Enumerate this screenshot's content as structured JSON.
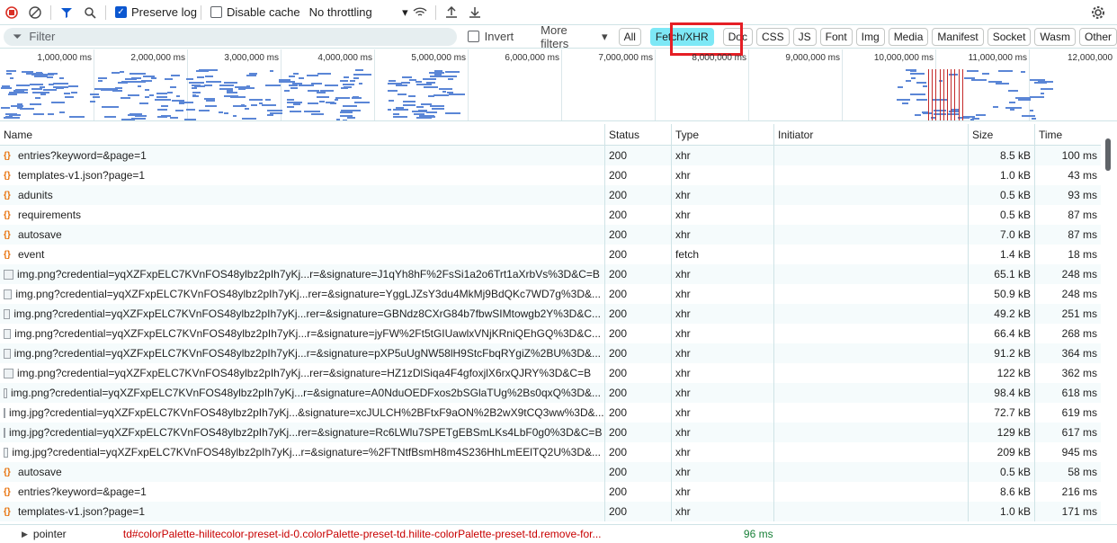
{
  "toolbar": {
    "preserve_log": "Preserve log",
    "disable_cache": "Disable cache",
    "throttling": "No throttling"
  },
  "filterbar": {
    "filter_placeholder": "Filter",
    "invert": "Invert",
    "more_filters": "More filters",
    "chips": [
      "All",
      "Fetch/XHR",
      "Doc",
      "CSS",
      "JS",
      "Font",
      "Img",
      "Media",
      "Manifest",
      "Socket",
      "Wasm",
      "Other"
    ],
    "active_chip": "Fetch/XHR"
  },
  "overview": {
    "ticks": [
      "1,000,000 ms",
      "2,000,000 ms",
      "3,000,000 ms",
      "4,000,000 ms",
      "5,000,000 ms",
      "6,000,000 ms",
      "7,000,000 ms",
      "8,000,000 ms",
      "9,000,000 ms",
      "10,000,000 ms",
      "11,000,000 ms",
      "12,000,000"
    ]
  },
  "table": {
    "headers": {
      "name": "Name",
      "status": "Status",
      "type": "Type",
      "initiator": "Initiator",
      "size": "Size",
      "time": "Time"
    },
    "rows": [
      {
        "icon": "xhr",
        "name": "entries?keyword=&page=1",
        "status": "200",
        "type": "xhr",
        "size": "8.5 kB",
        "time": "100 ms"
      },
      {
        "icon": "xhr",
        "name": "templates-v1.json?page=1",
        "status": "200",
        "type": "xhr",
        "size": "1.0 kB",
        "time": "43 ms"
      },
      {
        "icon": "xhr",
        "name": "adunits",
        "status": "200",
        "type": "xhr",
        "size": "0.5 kB",
        "time": "93 ms"
      },
      {
        "icon": "xhr",
        "name": "requirements",
        "status": "200",
        "type": "xhr",
        "size": "0.5 kB",
        "time": "87 ms"
      },
      {
        "icon": "xhr",
        "name": "autosave",
        "status": "200",
        "type": "xhr",
        "size": "7.0 kB",
        "time": "87 ms"
      },
      {
        "icon": "xhr",
        "name": "event",
        "status": "200",
        "type": "fetch",
        "size": "1.4 kB",
        "time": "18 ms"
      },
      {
        "icon": "img",
        "name": "img.png?credential=yqXZFxpELC7KVnFOS48ylbz2pIh7yKj...r=&signature=J1qYh8hF%2FsSi1a2o6Trt1aXrbVs%3D&C=B",
        "status": "200",
        "type": "xhr",
        "size": "65.1 kB",
        "time": "248 ms"
      },
      {
        "icon": "img",
        "name": "img.png?credential=yqXZFxpELC7KVnFOS48ylbz2pIh7yKj...rer=&signature=YggLJZsY3du4MkMj9BdQKc7WD7g%3D&...",
        "status": "200",
        "type": "xhr",
        "size": "50.9 kB",
        "time": "248 ms"
      },
      {
        "icon": "img",
        "name": "img.png?credential=yqXZFxpELC7KVnFOS48ylbz2pIh7yKj...rer=&signature=GBNdz8CXrG84b7fbwSIMtowgb2Y%3D&C...",
        "status": "200",
        "type": "xhr",
        "size": "49.2 kB",
        "time": "251 ms"
      },
      {
        "icon": "img",
        "name": "img.png?credential=yqXZFxpELC7KVnFOS48ylbz2pIh7yKj...r=&signature=jyFW%2Ft5tGIUawlxVNjKRniQEhGQ%3D&C...",
        "status": "200",
        "type": "xhr",
        "size": "66.4 kB",
        "time": "268 ms"
      },
      {
        "icon": "img",
        "name": "img.png?credential=yqXZFxpELC7KVnFOS48ylbz2pIh7yKj...r=&signature=pXP5uUgNW58lH9StcFbqRYgiZ%2BU%3D&...",
        "status": "200",
        "type": "xhr",
        "size": "91.2 kB",
        "time": "364 ms"
      },
      {
        "icon": "img",
        "name": "img.png?credential=yqXZFxpELC7KVnFOS48ylbz2pIh7yKj...rer=&signature=HZ1zDlSiqa4F4gfoxjlX6rxQJRY%3D&C=B",
        "status": "200",
        "type": "xhr",
        "size": "122 kB",
        "time": "362 ms"
      },
      {
        "icon": "img",
        "name": "img.png?credential=yqXZFxpELC7KVnFOS48ylbz2pIh7yKj...r=&signature=A0NduOEDFxos2bSGlaTUg%2Bs0qxQ%3D&...",
        "status": "200",
        "type": "xhr",
        "size": "98.4 kB",
        "time": "618 ms"
      },
      {
        "icon": "img",
        "name": "img.jpg?credential=yqXZFxpELC7KVnFOS48ylbz2pIh7yKj...&signature=xcJULCH%2BFtxF9aON%2B2wX9tCQ3ww%3D&...",
        "status": "200",
        "type": "xhr",
        "size": "72.7 kB",
        "time": "619 ms"
      },
      {
        "icon": "img",
        "name": "img.jpg?credential=yqXZFxpELC7KVnFOS48ylbz2pIh7yKj...rer=&signature=Rc6LWlu7SPETgEBSmLKs4LbF0g0%3D&C=B",
        "status": "200",
        "type": "xhr",
        "size": "129 kB",
        "time": "617 ms"
      },
      {
        "icon": "img",
        "name": "img.jpg?credential=yqXZFxpELC7KVnFOS48ylbz2pIh7yKj...r=&signature=%2FTNtfBsmH8m4S236HhLmEElTQ2U%3D&...",
        "status": "200",
        "type": "xhr",
        "size": "209 kB",
        "time": "945 ms"
      },
      {
        "icon": "xhr",
        "name": "autosave",
        "status": "200",
        "type": "xhr",
        "size": "0.5 kB",
        "time": "58 ms"
      },
      {
        "icon": "xhr",
        "name": "entries?keyword=&page=1",
        "status": "200",
        "type": "xhr",
        "size": "8.6 kB",
        "time": "216 ms"
      },
      {
        "icon": "xhr",
        "name": "templates-v1.json?page=1",
        "status": "200",
        "type": "xhr",
        "size": "1.0 kB",
        "time": "171 ms"
      }
    ]
  },
  "bottom": {
    "label": "pointer",
    "selector": "td#colorPalette-hilitecolor-preset-id-0.colorPalette-preset-td.hilite-colorPalette-preset-td.remove-for...",
    "time": "96 ms"
  }
}
